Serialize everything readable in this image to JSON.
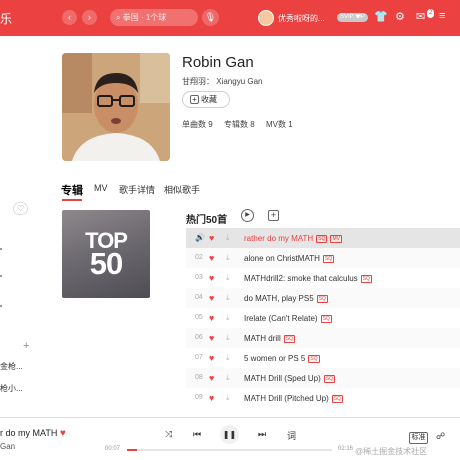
{
  "header": {
    "brand": "乐",
    "back_icon": "chevron-left-icon",
    "forward_icon": "chevron-right-icon",
    "search_placeholder": "拳国 · 1个球",
    "username": "优秀啦呀的...",
    "vip_badge": "SVIP VIP",
    "notifications": "2",
    "accent_color": "#ec4141"
  },
  "sidebar": {
    "playlists": [
      "金枪...",
      "枪小..."
    ]
  },
  "artist": {
    "name": "Robin Gan",
    "alias_label": "甘翔羽：",
    "alias_value": "Xiangyu Gan",
    "collect_label": "收藏",
    "stats": {
      "singles": "单曲数 9",
      "albums": "专辑数 8",
      "mvs": "MV数 1"
    }
  },
  "tabs": [
    {
      "label": "专辑",
      "active": true
    },
    {
      "label": "MV",
      "active": false
    },
    {
      "label": "歌手详情",
      "active": false
    },
    {
      "label": "相似歌手",
      "active": false
    }
  ],
  "album_cover": {
    "line1": "TOP",
    "line2": "50"
  },
  "top50": {
    "title": "热门50首",
    "songs": [
      {
        "index": "01",
        "name": "rather do my MATH",
        "tags": [
          "SQ",
          "MV"
        ],
        "playing": true
      },
      {
        "index": "02",
        "name": "alone on ChristMATH",
        "tags": [
          "SQ"
        ],
        "playing": false
      },
      {
        "index": "03",
        "name": "MATHdrill2: smoke that calculus",
        "tags": [
          "SQ"
        ],
        "playing": false
      },
      {
        "index": "04",
        "name": "do MATH, play PS5",
        "tags": [
          "SQ"
        ],
        "playing": false
      },
      {
        "index": "05",
        "name": "Irelate (Can't Relate)",
        "tags": [
          "SQ"
        ],
        "playing": false
      },
      {
        "index": "06",
        "name": "MATH drill",
        "tags": [
          "SQ"
        ],
        "playing": false
      },
      {
        "index": "07",
        "name": "5 women or PS 5",
        "tags": [
          "SQ"
        ],
        "playing": false
      },
      {
        "index": "08",
        "name": "MATH Drill (Sped Up)",
        "tags": [
          "SQ"
        ],
        "playing": false
      },
      {
        "index": "09",
        "name": "MATH Drill (Pitched Up)",
        "tags": [
          "SQ"
        ],
        "playing": false
      }
    ]
  },
  "player": {
    "title": "r do my MATH",
    "artist": "Gan",
    "current_time": "00:07",
    "total_time": "02:16",
    "progress": 0.05,
    "lyrics_label": "词",
    "quality_label": "标准"
  },
  "watermark": "@稀土掘金技术社区"
}
